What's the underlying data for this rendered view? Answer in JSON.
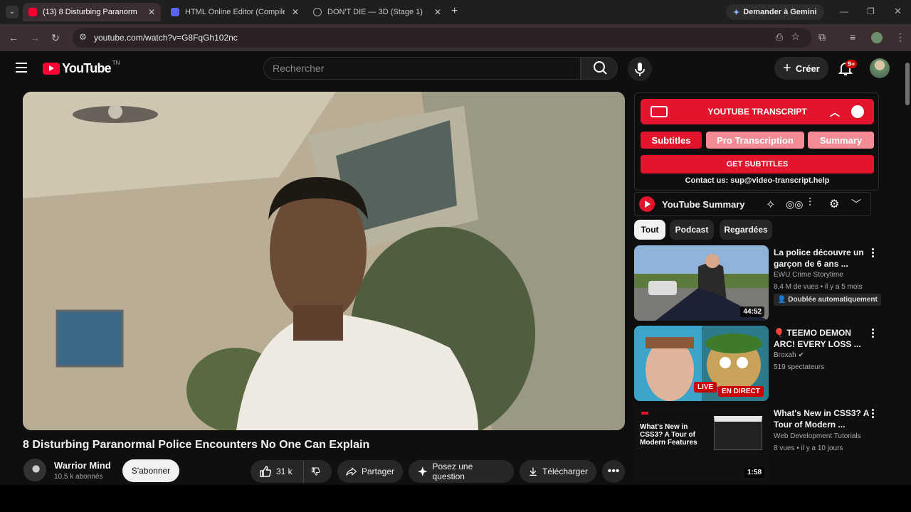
{
  "browser": {
    "tabs": [
      {
        "title": "(13) 8 Disturbing Paranorm",
        "active": true,
        "icon": "youtube-icon"
      },
      {
        "title": "HTML Online Editor (Compiler,",
        "active": false,
        "icon": "code-icon"
      },
      {
        "title": "DON'T DIE — 3D (Stage 1)",
        "active": false,
        "icon": "globe-icon"
      }
    ],
    "gemini_label": "Demander à Gemini",
    "url": "youtube.com/watch?v=G8FqGh102nc"
  },
  "youtube": {
    "logo_text": "YouTube",
    "logo_region": "TN",
    "search_placeholder": "Rechercher",
    "create_label": "Créer",
    "notification_count": "9+"
  },
  "video": {
    "title": "8 Disturbing Paranormal Police Encounters No One Can Explain",
    "channel": "Warrior Mind",
    "subscribers": "10,5 k abonnés",
    "subscribe_label": "S'abonner",
    "likes": "31 k",
    "share_label": "Partager",
    "ask_label": "Posez une question",
    "download_label": "Télécharger"
  },
  "extension": {
    "title": "YOUTUBE TRANSCRIPT",
    "buttons": [
      "Subtitles",
      "Pro Transcription",
      "Summary"
    ],
    "get_subtitles": "GET SUBTITLES",
    "contact": "Contact us: sup@video-transcript.help",
    "summary_title": "YouTube Summary"
  },
  "chips": [
    "Tout",
    "Podcast",
    "Regardées"
  ],
  "recommendations": [
    {
      "title": "La police découvre un garçon de 6 ans ...",
      "channel": "EWU Crime Storytime",
      "meta": "8,4 M de vues • il y a 5 mois",
      "badge": "Doublée automatiquement",
      "duration": "44:52"
    },
    {
      "title": "🎈 TEEMO DEMON ARC! EVERY LOSS ...",
      "channel": "Broxah",
      "meta": "519 spectateurs",
      "live": "LIVE",
      "en_direct": "EN DIRECT"
    },
    {
      "title": "What's New in CSS3? A Tour of Modern ...",
      "channel": "Web Development Tutorials",
      "meta": "8 vues • il y a 10 jours",
      "duration": "1:58",
      "thumb_text": "What's New in CSS3? A Tour of Modern Features"
    }
  ]
}
